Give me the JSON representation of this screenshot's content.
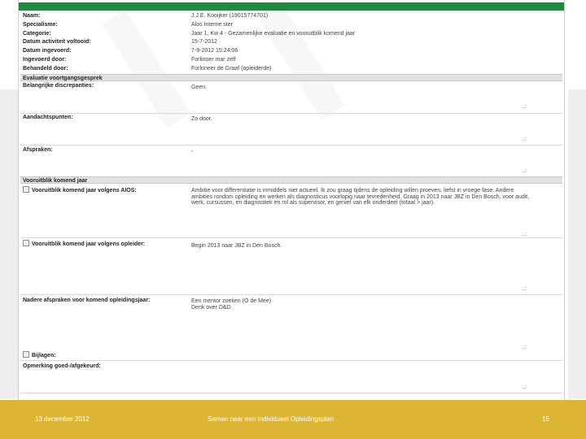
{
  "header_fields": [
    {
      "label": "Naam:",
      "value": "J.J.E. Kooijker (19015774701)"
    },
    {
      "label": "Specialisme:",
      "value": "Alos Interne ster"
    },
    {
      "label": "Categorie:",
      "value": "Jaar 1, Kw 4 - Gezamenlijke evaluatie en vooruitblik komend jaar"
    },
    {
      "label": "Datum activiteit voltooid:",
      "value": "15-7-2012"
    },
    {
      "label": "Datum ingevoerd:",
      "value": "7-9-2012 15:24:06"
    },
    {
      "label": "Ingevoerd door:",
      "value": "Forlinoer mar zelf"
    },
    {
      "label": "Behandeld door:",
      "value": "Forloneer de Graaf (opleiderde)"
    }
  ],
  "sections": {
    "evaluatie": "Evaluatie voortgangsgesprek",
    "vooruitblik": "Vooruitblik komend jaar"
  },
  "evaluatie_fields": [
    {
      "label": "Belangrijke discrepanties:",
      "value": "Geen."
    },
    {
      "label": "Aandachtspunten:",
      "value": "Zo door."
    },
    {
      "label": "Afspraken:",
      "value": "-"
    }
  ],
  "vooruitblik_fields": [
    {
      "label": "Vooruitblik komend jaar volgens AIOS:",
      "value": "Ambitie voor differentiatie is inmiddels niet actueel. Ik zou graag tijdens de opleiding willen proeven, liefst in vroege fase. Andere ambities rondom opleiding en werken als diagnosticus voorlopig naar tevredenheid. Graag in 2013 naar JBZ in Den Bosch, voor audit, werk, cursussen, en diagnostiek en rol als supervisor, en geniet van elk onderdeel (totaal > jaar)."
    },
    {
      "label": "Vooruitblik komend jaar volgens opleider:",
      "value": "Begin 2013 naar JBZ in Den Bosch."
    },
    {
      "label": "Nadere afspraken voor komend opleidingsjaar:",
      "value": "Een mentor zoeken (O de Mee)\nDenk over D&D"
    },
    {
      "label": "Bijlagen:",
      "value": ""
    },
    {
      "label": "Opmerking goed-/afgekeurd:",
      "value": ""
    }
  ],
  "resize_marks": [
    "..:",
    "..:",
    "..:",
    "..:",
    "..:",
    "..:",
    "..:",
    "..:"
  ],
  "footer": {
    "date": "13 december 2012",
    "title": "Samen naar een Individueel Opleidingsplan",
    "page": "15"
  },
  "colors": {
    "accent_green": "#1f8a3b",
    "footer_gold": "#ddb534"
  }
}
